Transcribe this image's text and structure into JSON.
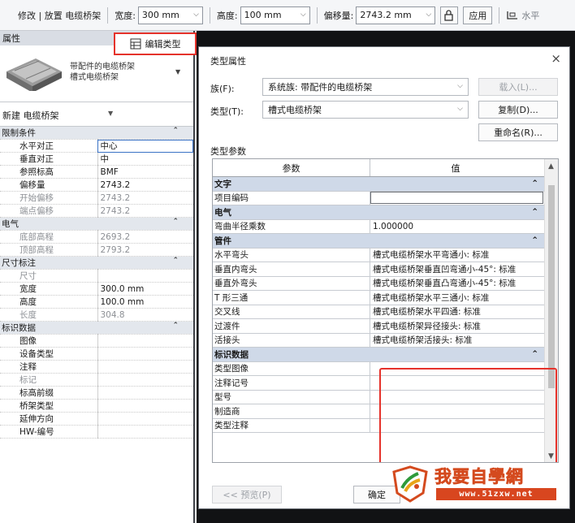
{
  "options_bar": {
    "context": "修改 | 放置 电缆桥架",
    "width_label": "宽度:",
    "width_value": "300 mm",
    "height_label": "高度:",
    "height_value": "100 mm",
    "offset_label": "偏移量:",
    "offset_value": "2743.2 mm",
    "apply_label": "应用",
    "horizontal_label": "水平"
  },
  "properties": {
    "title": "属性",
    "close": "×",
    "type_name_line1": "带配件的电缆桥架",
    "type_name_line2": "槽式电缆桥架",
    "instance_label": "新建 电缆桥架",
    "edit_type_label": "编辑类型",
    "groups": [
      {
        "name": "限制条件",
        "rows": [
          {
            "key": "水平对正",
            "value": "中心",
            "grey": false
          },
          {
            "key": "垂直对正",
            "value": "中",
            "grey": false
          },
          {
            "key": "参照标高",
            "value": "BMF",
            "grey": false
          },
          {
            "key": "偏移量",
            "value": "2743.2",
            "grey": false
          },
          {
            "key": "开始偏移",
            "value": "2743.2",
            "grey": true
          },
          {
            "key": "端点偏移",
            "value": "2743.2",
            "grey": true
          }
        ]
      },
      {
        "name": "电气",
        "rows": [
          {
            "key": "底部高程",
            "value": "2693.2",
            "grey": true
          },
          {
            "key": "顶部高程",
            "value": "2793.2",
            "grey": true
          }
        ]
      },
      {
        "name": "尺寸标注",
        "rows": [
          {
            "key": "尺寸",
            "value": "",
            "grey": true
          },
          {
            "key": "宽度",
            "value": "300.0 mm",
            "grey": false
          },
          {
            "key": "高度",
            "value": "100.0 mm",
            "grey": false
          },
          {
            "key": "长度",
            "value": "304.8",
            "grey": true
          }
        ]
      },
      {
        "name": "标识数据",
        "rows": [
          {
            "key": "图像",
            "value": "",
            "grey": false
          },
          {
            "key": "设备类型",
            "value": "",
            "grey": false
          },
          {
            "key": "注释",
            "value": "",
            "grey": false
          },
          {
            "key": "标记",
            "value": "",
            "grey": true
          },
          {
            "key": "标高前缀",
            "value": "",
            "grey": false
          },
          {
            "key": "桥架类型",
            "value": "",
            "grey": false
          },
          {
            "key": "延伸方向",
            "value": "",
            "grey": false
          },
          {
            "key": "HW-编号",
            "value": "",
            "grey": false
          }
        ]
      }
    ]
  },
  "dialog": {
    "title": "类型属性",
    "close": "×",
    "family_label": "族(F):",
    "family_value": "系统族: 带配件的电缆桥架",
    "type_label": "类型(T):",
    "type_value": "槽式电缆桥架",
    "load_button": "载入(L)...",
    "duplicate_button": "复制(D)...",
    "rename_button": "重命名(R)...",
    "params_label": "类型参数",
    "col_param": "参数",
    "col_value": "值",
    "groups": [
      {
        "name": "文字",
        "rows": [
          {
            "key": "项目编码",
            "value": "",
            "input": true
          }
        ]
      },
      {
        "name": "电气",
        "rows": [
          {
            "key": "弯曲半径乘数",
            "value": "1.000000"
          }
        ]
      },
      {
        "name": "管件",
        "rows": [
          {
            "key": "水平弯头",
            "value": "槽式电缆桥架水平弯通小: 标准"
          },
          {
            "key": "垂直内弯头",
            "value": "槽式电缆桥架垂直凹弯通小-45°: 标准"
          },
          {
            "key": "垂直外弯头",
            "value": "槽式电缆桥架垂直凸弯通小-45°: 标准"
          },
          {
            "key": "T 形三通",
            "value": "槽式电缆桥架水平三通小: 标准"
          },
          {
            "key": "交叉线",
            "value": "槽式电缆桥架水平四通: 标准"
          },
          {
            "key": "过渡件",
            "value": "槽式电缆桥架异径接头: 标准"
          },
          {
            "key": "活接头",
            "value": "槽式电缆桥架活接头: 标准"
          }
        ]
      },
      {
        "name": "标识数据",
        "rows": [
          {
            "key": "类型图像",
            "value": ""
          },
          {
            "key": "注释记号",
            "value": ""
          },
          {
            "key": "型号",
            "value": ""
          },
          {
            "key": "制造商",
            "value": ""
          },
          {
            "key": "类型注释",
            "value": ""
          }
        ]
      }
    ],
    "preview_button": "<< 预览(P)",
    "ok_button": "确定"
  },
  "watermark": {
    "text": "我要自學網",
    "url": "www.51zxw.net"
  },
  "colors": {
    "highlight_red": "#e5322b",
    "group_blue": "#cfd9e8"
  }
}
